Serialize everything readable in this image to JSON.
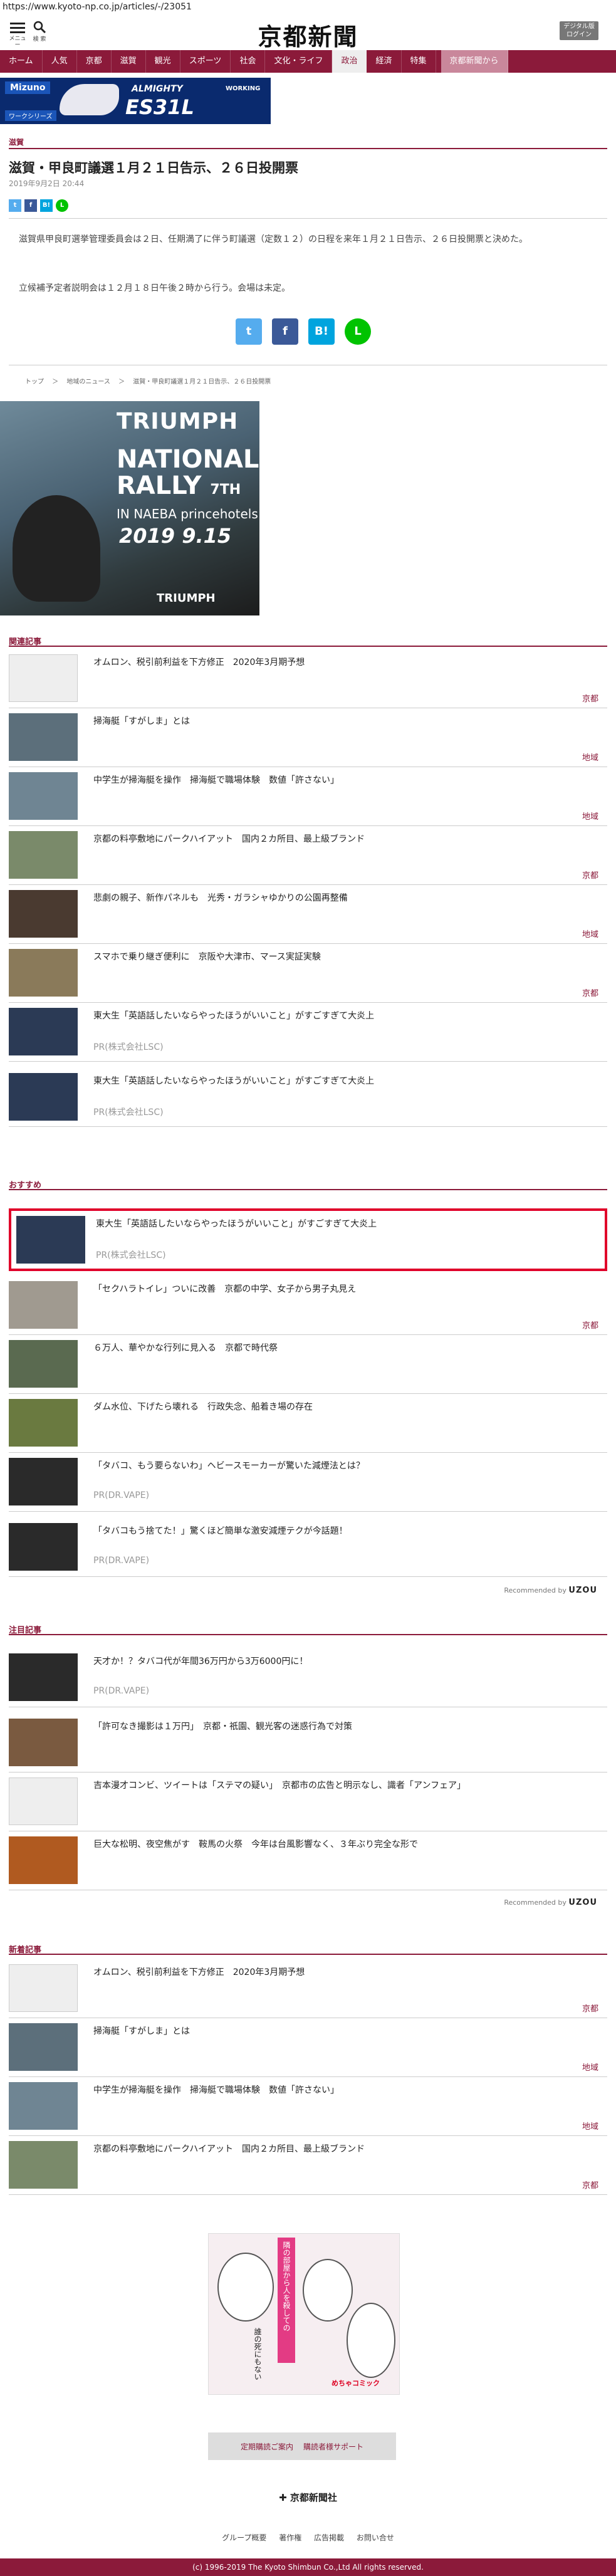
{
  "url": "https://www.kyoto-np.co.jp/articles/-/23051",
  "header": {
    "menu_label": "メニュー",
    "search_label": "検 索",
    "logo": "京都新聞",
    "login_label_1": "デジタル版",
    "login_label_2": "ログイン"
  },
  "nav": {
    "items": [
      "ホーム",
      "人気",
      "京都",
      "滋賀",
      "観光",
      "スポーツ",
      "社会",
      "文化・ライフ",
      "政治",
      "経済",
      "特集"
    ],
    "special": "京都新聞から"
  },
  "ad_banner": {
    "brand": "Mizuno",
    "line1": "ALMIGHTY",
    "model": "ES31L",
    "tag": "WORKING",
    "series": "ワークシリーズ"
  },
  "article": {
    "category": "滋賀",
    "title": "滋賀・甲良町議選１月２１日告示、２６日投開票",
    "date": "2019年9月2日 20:44",
    "p1": "滋賀県甲良町選挙管理委員会は２日、任期満了に伴う町議選（定数１２）の日程を来年１月２１日告示、２６日投開票と決めた。",
    "p2": "立候補予定者説明会は１２月１８日午後２時から行う。会場は未定。",
    "breadcrumb": [
      "トップ",
      "＞",
      "地域のニュース",
      "＞",
      "滋賀・甲良町議選１月２１日告示、２６日投開票"
    ]
  },
  "triumph_ad": {
    "brand": "TRIUMPH",
    "line1": "NATIONAL",
    "line2": "RALLY",
    "edition": "7TH",
    "venue": "IN NAEBA princehotels",
    "date": "2019 9.15",
    "logo": "TRIUMPH"
  },
  "related": {
    "title": "関連記事",
    "items": [
      {
        "title": "オムロン、税引前利益を下方修正　2020年3月期予想",
        "tag": "京都"
      },
      {
        "title": "掃海艇「すがしま」とは",
        "tag": "地域"
      },
      {
        "title": "中学生が掃海艇を操作　掃海艇で職場体験　数値「許さない」",
        "tag": "地域"
      },
      {
        "title": "京都の料亭敷地にパークハイアット　国内２カ所目、最上級ブランド",
        "tag": "京都"
      },
      {
        "title": "悲劇の親子、新作パネルも　光秀・ガラシャゆかりの公園再整備",
        "tag": "地域"
      },
      {
        "title": "スマホで乗り継ぎ便利に　京阪や大津市、マース実証実験",
        "tag": "京都"
      },
      {
        "title": "東大生「英語話したいならやったほうがいいこと」がすごすぎて大炎上",
        "sub": "PR(株式会社LSC)"
      },
      {
        "title": "東大生「英語話したいならやったほうがいいこと」がすごすぎて大炎上",
        "sub": "PR(株式会社LSC)"
      }
    ]
  },
  "recommended": {
    "title": "おすすめ",
    "items": [
      {
        "title": "東大生「英語話したいならやったほうがいいこと」がすごすぎて大炎上",
        "sub": "PR(株式会社LSC)"
      },
      {
        "title": "「セクハラトイレ」ついに改善　京都の中学、女子から男子丸見え",
        "tag": "京都"
      },
      {
        "title": "６万人、華やかな行列に見入る　京都で時代祭",
        "tag": ""
      },
      {
        "title": "ダム水位、下げたら壊れる　行政失念、船着き場の存在",
        "tag": ""
      },
      {
        "title": "「タバコ、もう要らないわ」ヘビースモーカーが驚いた減煙法とは？",
        "sub": "PR(DR.VAPE)"
      },
      {
        "title": "「タバコもう捨てた！」驚くほど簡単な激安減煙テクが今話題！",
        "sub": "PR(DR.VAPE)"
      }
    ],
    "credit": "Recommended by",
    "credit_brand": "UZOU"
  },
  "notable": {
    "title": "注目記事",
    "items": [
      {
        "title": "天才か！？タバコ代が年間36万円から3万6000円に！",
        "sub": "PR(DR.VAPE)"
      },
      {
        "title": "「許可なき撮影は１万円」　京都・祇園、観光客の迷惑行為で対策",
        "tag": ""
      },
      {
        "title": "吉本漫才コンビ、ツイートは「ステマの疑い」　京都市の広告と明示なし、識者「アンフェア」",
        "tag": ""
      },
      {
        "title": "巨大な松明、夜空焦がす　鞍馬の火祭　今年は台風影響なく、３年ぶり完全な形で",
        "tag": ""
      }
    ],
    "credit": "Recommended by",
    "credit_brand": "UZOU"
  },
  "latest": {
    "title": "新着記事",
    "items": [
      {
        "title": "オムロン、税引前利益を下方修正　2020年3月期予想",
        "tag": "京都"
      },
      {
        "title": "掃海艇「すがしま」とは",
        "tag": "地域"
      },
      {
        "title": "中学生が掃海艇を操作　掃海艇で職場体験　数値「許さない」",
        "tag": "地域"
      },
      {
        "title": "京都の料亭敷地にパークハイアット　国内２カ所目、最上級ブランド",
        "tag": "京都"
      }
    ]
  },
  "manga_ad": {
    "line1": "隣の部屋から人を殺しての",
    "line2": "誰の死にもない",
    "brand": "めちゃコミック"
  },
  "footer": {
    "btn1": "定期購読ご案内",
    "btn2": "購読者様サポート",
    "company": "京都新聞社",
    "links": [
      "グループ概要",
      "著作権",
      "広告掲載",
      "お問い合せ"
    ],
    "copyright": "(c) 1996-2019 The Kyoto Shimbun Co.,Ltd All rights reserved."
  },
  "colors": {
    "brand": "#8b1a3a",
    "highlight": "#e0002a",
    "tag": "#8b1a3a"
  }
}
